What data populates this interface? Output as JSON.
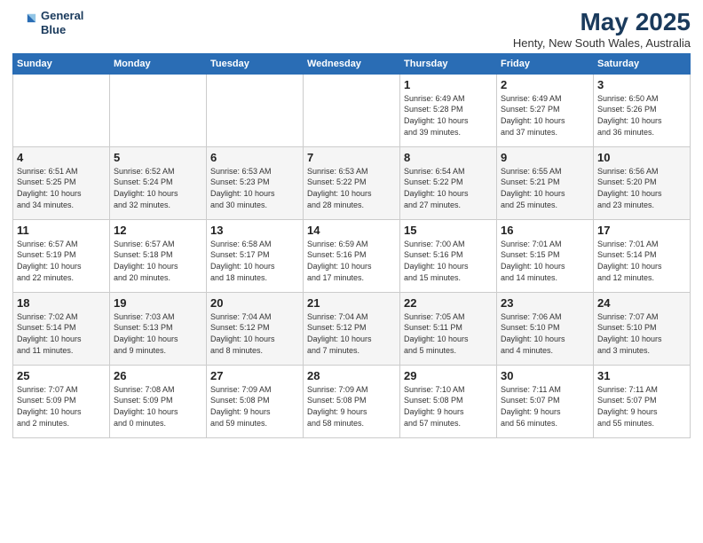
{
  "header": {
    "logo_line1": "General",
    "logo_line2": "Blue",
    "title": "May 2025",
    "subtitle": "Henty, New South Wales, Australia"
  },
  "days_of_week": [
    "Sunday",
    "Monday",
    "Tuesday",
    "Wednesday",
    "Thursday",
    "Friday",
    "Saturday"
  ],
  "weeks": [
    [
      {
        "day": "",
        "detail": ""
      },
      {
        "day": "",
        "detail": ""
      },
      {
        "day": "",
        "detail": ""
      },
      {
        "day": "",
        "detail": ""
      },
      {
        "day": "1",
        "detail": "Sunrise: 6:49 AM\nSunset: 5:28 PM\nDaylight: 10 hours\nand 39 minutes."
      },
      {
        "day": "2",
        "detail": "Sunrise: 6:49 AM\nSunset: 5:27 PM\nDaylight: 10 hours\nand 37 minutes."
      },
      {
        "day": "3",
        "detail": "Sunrise: 6:50 AM\nSunset: 5:26 PM\nDaylight: 10 hours\nand 36 minutes."
      }
    ],
    [
      {
        "day": "4",
        "detail": "Sunrise: 6:51 AM\nSunset: 5:25 PM\nDaylight: 10 hours\nand 34 minutes."
      },
      {
        "day": "5",
        "detail": "Sunrise: 6:52 AM\nSunset: 5:24 PM\nDaylight: 10 hours\nand 32 minutes."
      },
      {
        "day": "6",
        "detail": "Sunrise: 6:53 AM\nSunset: 5:23 PM\nDaylight: 10 hours\nand 30 minutes."
      },
      {
        "day": "7",
        "detail": "Sunrise: 6:53 AM\nSunset: 5:22 PM\nDaylight: 10 hours\nand 28 minutes."
      },
      {
        "day": "8",
        "detail": "Sunrise: 6:54 AM\nSunset: 5:22 PM\nDaylight: 10 hours\nand 27 minutes."
      },
      {
        "day": "9",
        "detail": "Sunrise: 6:55 AM\nSunset: 5:21 PM\nDaylight: 10 hours\nand 25 minutes."
      },
      {
        "day": "10",
        "detail": "Sunrise: 6:56 AM\nSunset: 5:20 PM\nDaylight: 10 hours\nand 23 minutes."
      }
    ],
    [
      {
        "day": "11",
        "detail": "Sunrise: 6:57 AM\nSunset: 5:19 PM\nDaylight: 10 hours\nand 22 minutes."
      },
      {
        "day": "12",
        "detail": "Sunrise: 6:57 AM\nSunset: 5:18 PM\nDaylight: 10 hours\nand 20 minutes."
      },
      {
        "day": "13",
        "detail": "Sunrise: 6:58 AM\nSunset: 5:17 PM\nDaylight: 10 hours\nand 18 minutes."
      },
      {
        "day": "14",
        "detail": "Sunrise: 6:59 AM\nSunset: 5:16 PM\nDaylight: 10 hours\nand 17 minutes."
      },
      {
        "day": "15",
        "detail": "Sunrise: 7:00 AM\nSunset: 5:16 PM\nDaylight: 10 hours\nand 15 minutes."
      },
      {
        "day": "16",
        "detail": "Sunrise: 7:01 AM\nSunset: 5:15 PM\nDaylight: 10 hours\nand 14 minutes."
      },
      {
        "day": "17",
        "detail": "Sunrise: 7:01 AM\nSunset: 5:14 PM\nDaylight: 10 hours\nand 12 minutes."
      }
    ],
    [
      {
        "day": "18",
        "detail": "Sunrise: 7:02 AM\nSunset: 5:14 PM\nDaylight: 10 hours\nand 11 minutes."
      },
      {
        "day": "19",
        "detail": "Sunrise: 7:03 AM\nSunset: 5:13 PM\nDaylight: 10 hours\nand 9 minutes."
      },
      {
        "day": "20",
        "detail": "Sunrise: 7:04 AM\nSunset: 5:12 PM\nDaylight: 10 hours\nand 8 minutes."
      },
      {
        "day": "21",
        "detail": "Sunrise: 7:04 AM\nSunset: 5:12 PM\nDaylight: 10 hours\nand 7 minutes."
      },
      {
        "day": "22",
        "detail": "Sunrise: 7:05 AM\nSunset: 5:11 PM\nDaylight: 10 hours\nand 5 minutes."
      },
      {
        "day": "23",
        "detail": "Sunrise: 7:06 AM\nSunset: 5:10 PM\nDaylight: 10 hours\nand 4 minutes."
      },
      {
        "day": "24",
        "detail": "Sunrise: 7:07 AM\nSunset: 5:10 PM\nDaylight: 10 hours\nand 3 minutes."
      }
    ],
    [
      {
        "day": "25",
        "detail": "Sunrise: 7:07 AM\nSunset: 5:09 PM\nDaylight: 10 hours\nand 2 minutes."
      },
      {
        "day": "26",
        "detail": "Sunrise: 7:08 AM\nSunset: 5:09 PM\nDaylight: 10 hours\nand 0 minutes."
      },
      {
        "day": "27",
        "detail": "Sunrise: 7:09 AM\nSunset: 5:08 PM\nDaylight: 9 hours\nand 59 minutes."
      },
      {
        "day": "28",
        "detail": "Sunrise: 7:09 AM\nSunset: 5:08 PM\nDaylight: 9 hours\nand 58 minutes."
      },
      {
        "day": "29",
        "detail": "Sunrise: 7:10 AM\nSunset: 5:08 PM\nDaylight: 9 hours\nand 57 minutes."
      },
      {
        "day": "30",
        "detail": "Sunrise: 7:11 AM\nSunset: 5:07 PM\nDaylight: 9 hours\nand 56 minutes."
      },
      {
        "day": "31",
        "detail": "Sunrise: 7:11 AM\nSunset: 5:07 PM\nDaylight: 9 hours\nand 55 minutes."
      }
    ]
  ]
}
